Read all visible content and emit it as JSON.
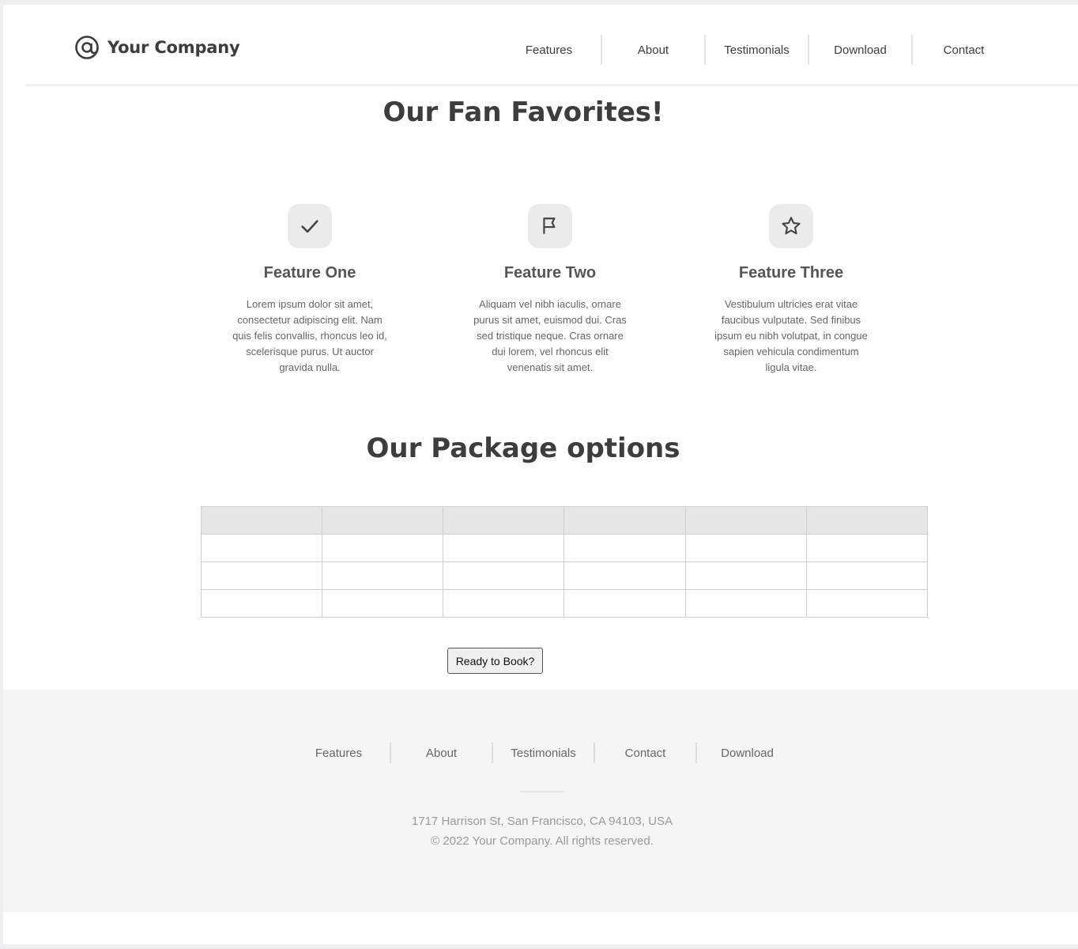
{
  "header": {
    "company_name": "Your Company",
    "nav": [
      "Features",
      "About",
      "Testimonials",
      "Download",
      "Contact"
    ]
  },
  "favorites": {
    "title": "Our Fan Favorites!",
    "features": [
      {
        "icon": "check-icon",
        "title": "Feature One",
        "text": "Lorem ipsum dolor sit amet, consectetur adipiscing elit. Nam quis felis convallis, rhoncus leo id, scelerisque purus. Ut auctor gravida nulla."
      },
      {
        "icon": "flag-icon",
        "title": "Feature Two",
        "text": "Aliquam vel nibh iaculis, ornare purus sit amet, euismod dui. Cras sed tristique neque. Cras ornare dui lorem, vel rhoncus elit venenatis sit amet."
      },
      {
        "icon": "star-icon",
        "title": "Feature Three",
        "text": "Vestibulum ultricies erat vitae faucibus vulputate. Sed finibus ipsum eu nibh volutpat, in congue sapien vehicula condimentum ligula vitae."
      }
    ]
  },
  "packages": {
    "title": "Our Package options",
    "columns": 6,
    "rows": 3,
    "book_button": "Ready to Book?"
  },
  "footer": {
    "nav": [
      "Features",
      "About",
      "Testimonials",
      "Contact",
      "Download"
    ],
    "address": "1717 Harrison St, San Francisco, CA 94103, USA",
    "copyright": "© 2022 Your Company.  All rights reserved."
  },
  "colors": {
    "text_dark": "#3d3d3d",
    "icon_bg": "#ebebeb",
    "table_header_bg": "#e6e6e6",
    "footer_bg": "#f5f5f5"
  }
}
